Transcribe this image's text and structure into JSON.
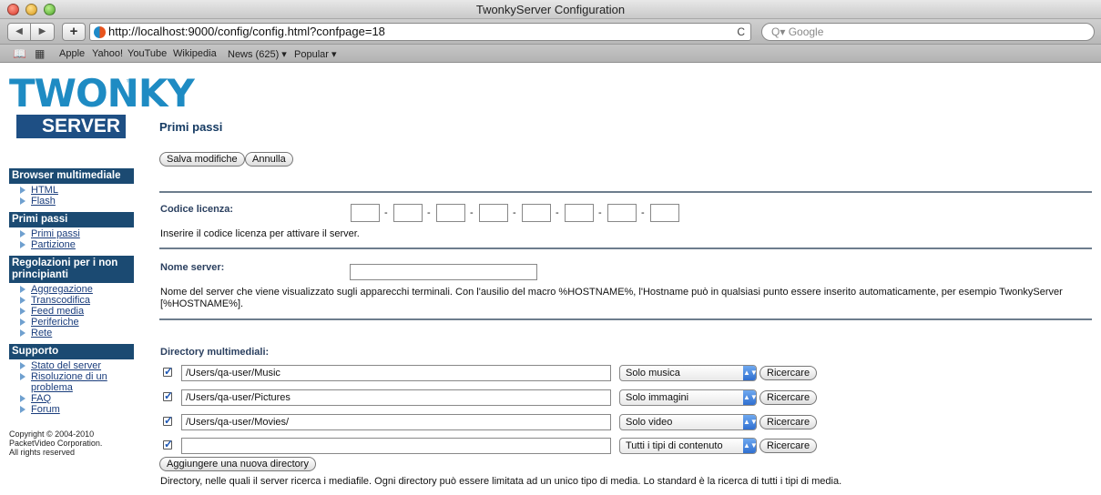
{
  "window": {
    "title": "TwonkyServer Configuration"
  },
  "toolbar": {
    "back": "◀",
    "forward": "▶",
    "add": "+",
    "url": "http://localhost:9000/config/config.html?confpage=18",
    "reload": "C",
    "search_placeholder": "Q▾ Google"
  },
  "bookmarks": {
    "items": [
      "Apple",
      "Yahoo!",
      "YouTube",
      "Wikipedia",
      "News (625) ▾",
      "Popular ▾"
    ]
  },
  "logo": {
    "word": "TWONKY",
    "tm": "™",
    "server": "SERVER"
  },
  "sidebar": {
    "sections": [
      {
        "title": "Browser multimediale",
        "items": [
          "HTML",
          "Flash"
        ]
      },
      {
        "title": "Primi passi",
        "items": [
          "Primi passi",
          "Partizione"
        ]
      },
      {
        "title": "Regolazioni per i non principianti",
        "items": [
          "Aggregazione",
          "Transcodifica",
          "Feed media",
          "Periferiche",
          "Rete"
        ]
      },
      {
        "title": "Supporto",
        "items": [
          "Stato del server",
          "Risoluzione di un problema",
          "FAQ",
          "Forum"
        ]
      }
    ],
    "copyright": "Copyright © 2004-2010\nPacketVideo Corporation.\nAll rights reserved"
  },
  "main": {
    "title": "Primi passi",
    "save_label": "Salva modifiche",
    "cancel_label": "Annulla",
    "license": {
      "label": "Codice licenza:",
      "desc": "Inserire il codice licenza per attivare il server.",
      "dash": "-"
    },
    "server_name": {
      "label": "Nome server:",
      "value": "",
      "desc": "Nome del server che viene visualizzato sugli apparecchi terminali. Con l'ausilio del macro %HOSTNAME%, l'Hostname può in qualsiasi punto essere inserito automaticamente, per esempio TwonkyServer [%HOSTNAME%]."
    },
    "directories": {
      "label": "Directory multimediali:",
      "rows": [
        {
          "path": "/Users/qa-user/Music",
          "type": "Solo musica",
          "checked": true
        },
        {
          "path": "/Users/qa-user/Pictures",
          "type": "Solo immagini",
          "checked": true
        },
        {
          "path": "/Users/qa-user/Movies/",
          "type": "Solo video",
          "checked": true
        },
        {
          "path": "",
          "type": "Tutti i tipi di contenuto",
          "checked": true
        }
      ],
      "scan_label": "Ricercare",
      "add_label": "Aggiungere una nuova directory",
      "desc": "Directory, nelle quali il server ricerca i mediafile. Ogni directory può essere limitata ad un unico tipo di media. Lo standard è la ricerca di tutti i tipi di media."
    }
  }
}
